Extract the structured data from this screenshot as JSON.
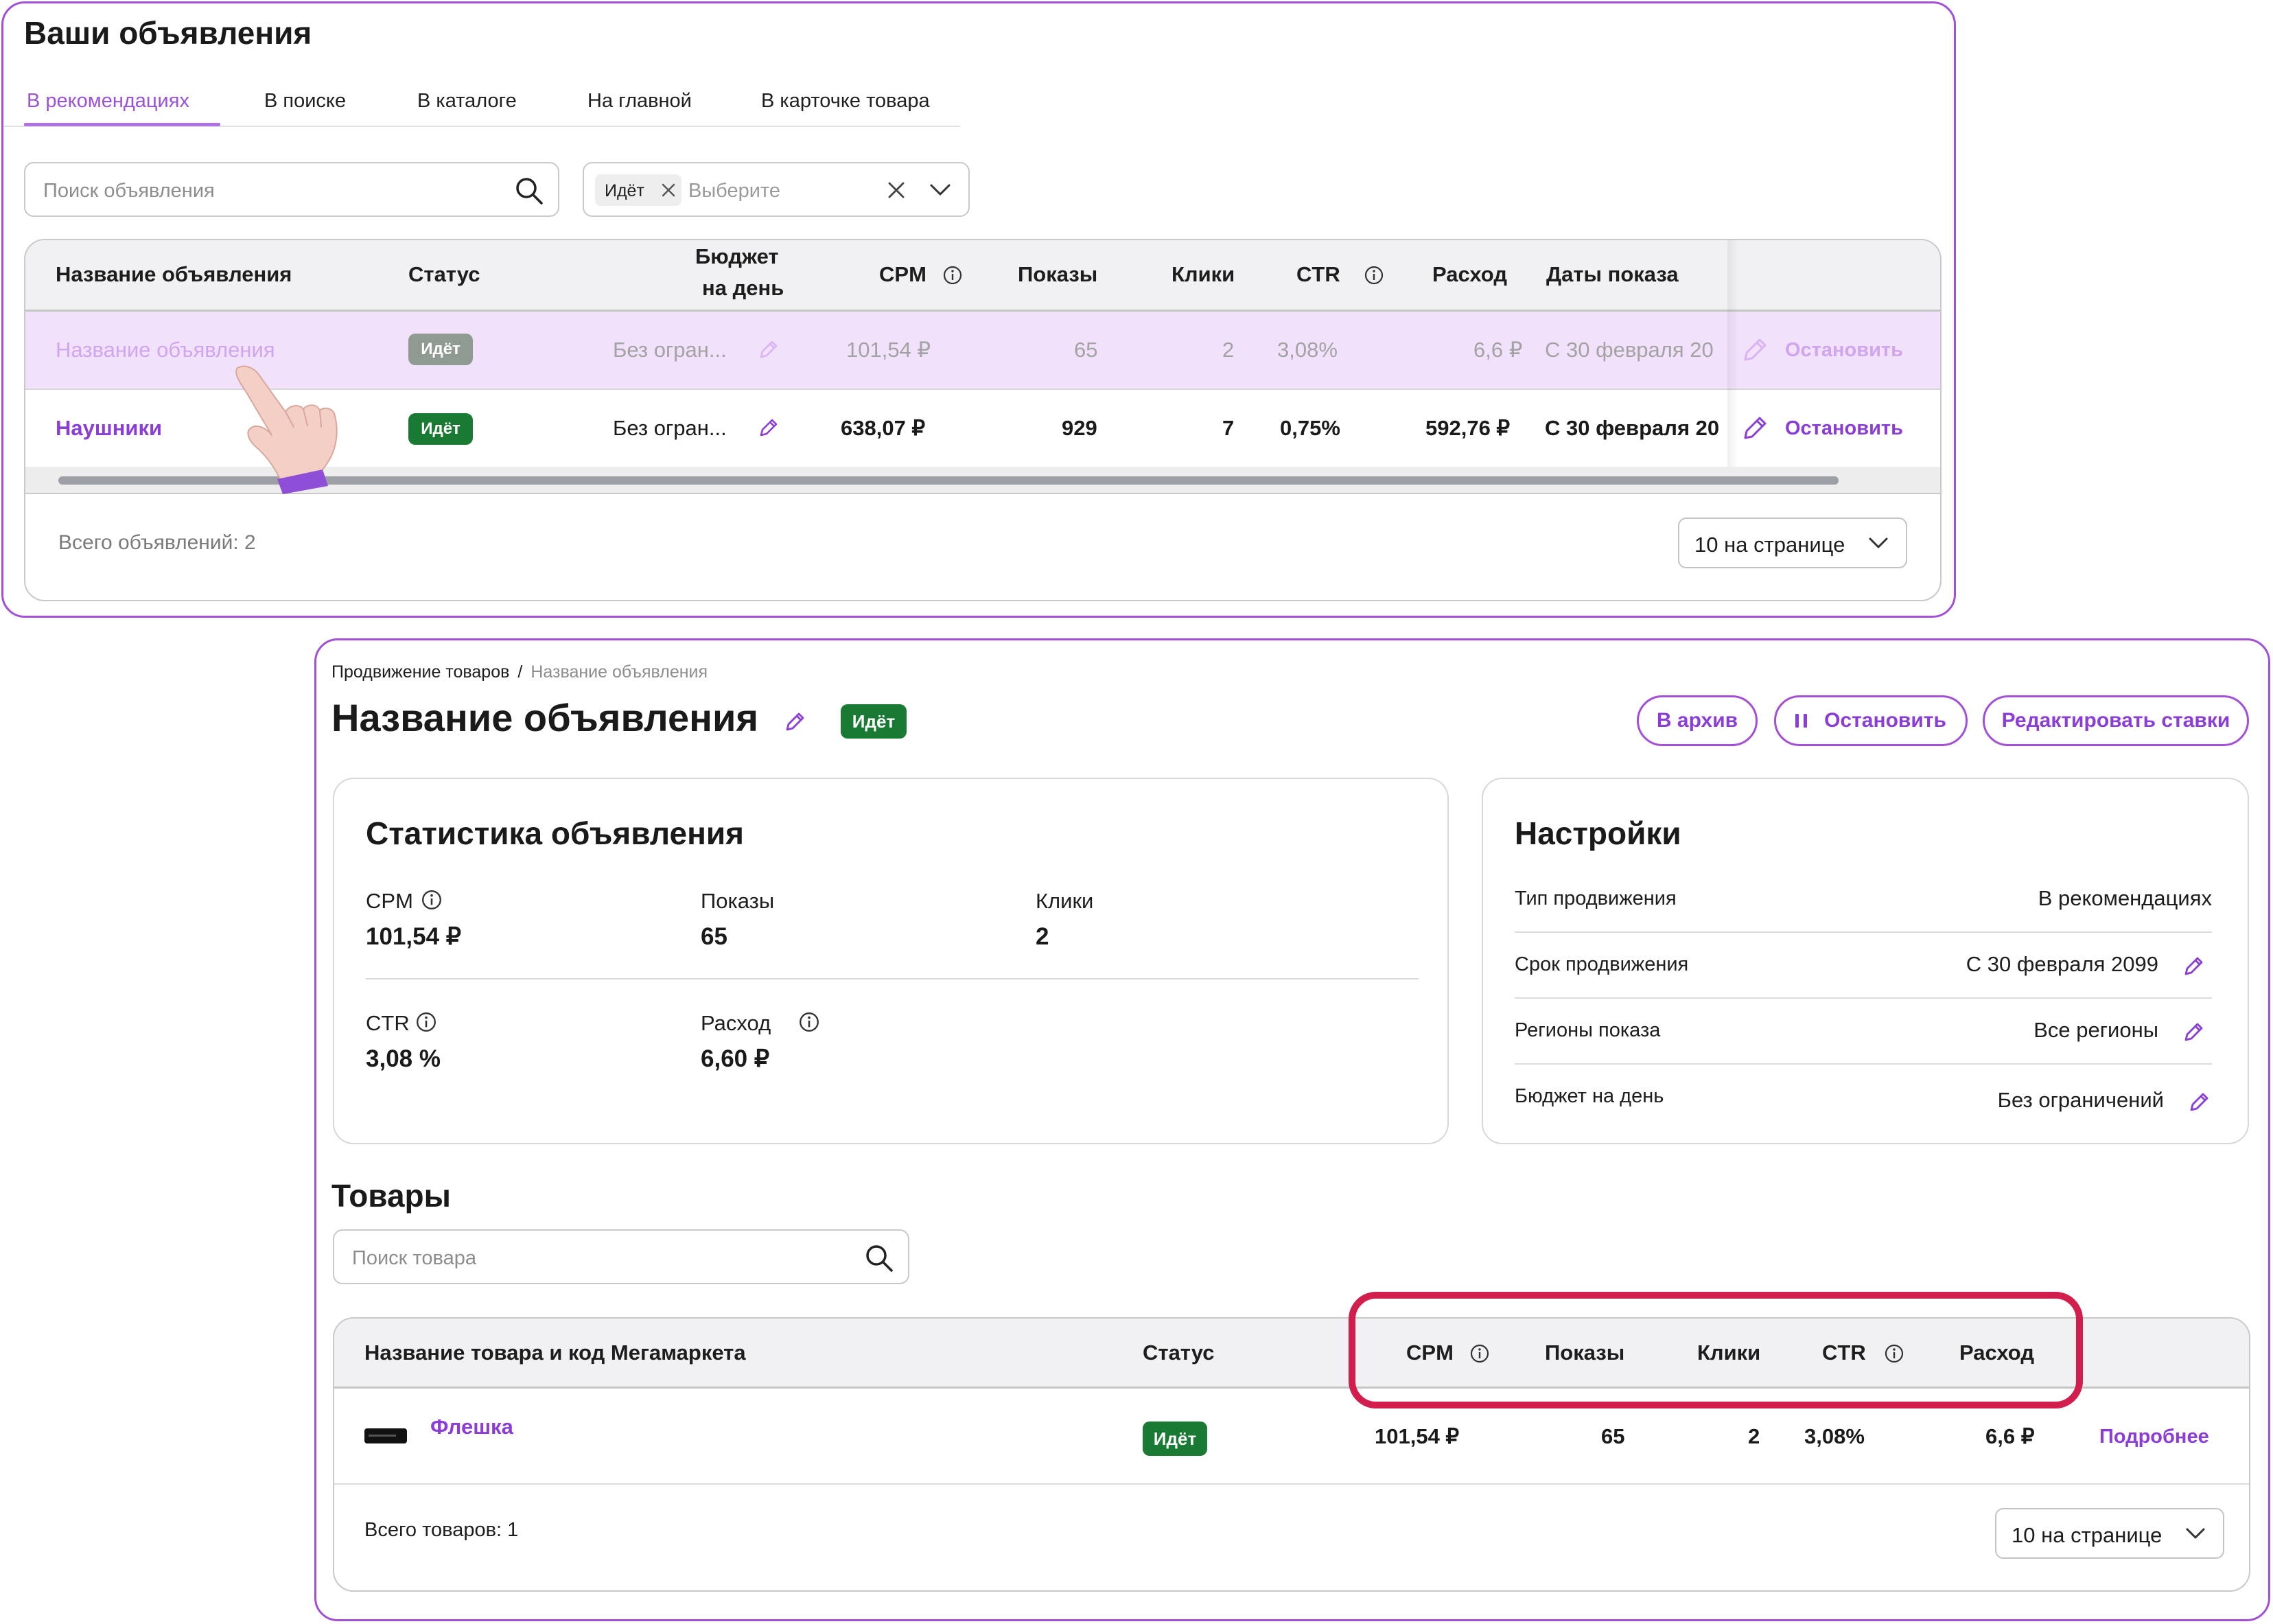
{
  "colors": {
    "accent": "#8b3ed6",
    "success": "#197a33",
    "highlight": "#d21e4c",
    "muted_badge": "#8f9a90"
  },
  "panel1": {
    "title": "Ваши объявления",
    "tabs": [
      "В рекомендациях",
      "В поиске",
      "В каталоге",
      "На главной",
      "В карточке товара"
    ],
    "search": {
      "placeholder": "Поиск объявления"
    },
    "filter": {
      "chip": "Идёт",
      "placeholder": "Выберите"
    },
    "table": {
      "headers": {
        "name": "Название объявления",
        "status": "Статус",
        "budget_1": "Бюджет",
        "budget_2": "на день",
        "cpm": "CPM",
        "shows": "Показы",
        "clicks": "Клики",
        "ctr": "CTR",
        "spend": "Расход",
        "dates": "Даты показа"
      },
      "rows": [
        {
          "name": "Название объявления",
          "status": "Идёт",
          "budget": "Без огран...",
          "cpm": "101,54 ₽",
          "shows": "65",
          "clicks": "2",
          "ctr": "3,08%",
          "spend": "6,6 ₽",
          "dates": "С 30 февраля 20",
          "action": "Остановить"
        },
        {
          "name": "Наушники",
          "status": "Идёт",
          "budget": "Без огран...",
          "cpm": "638,07 ₽",
          "shows": "929",
          "clicks": "7",
          "ctr": "0,75%",
          "spend": "592,76 ₽",
          "dates": "С 30 февраля 20",
          "action": "Остановить"
        }
      ]
    },
    "total": "Всего объявлений: 2",
    "pager": "10 на странице"
  },
  "panel2": {
    "breadcrumb": [
      "Продвижение товаров",
      "/",
      "Название объявления"
    ],
    "title": "Название объявления",
    "status": "Идёт",
    "buttons": {
      "archive": "В архив",
      "stop": "Остановить",
      "edit_bids": "Редактировать ставки"
    },
    "stats": {
      "title": "Статистика объявления",
      "cpm_label": "CPM",
      "cpm": "101,54 ₽",
      "shows_label": "Показы",
      "shows": "65",
      "clicks_label": "Клики",
      "clicks": "2",
      "ctr_label": "CTR",
      "ctr": "3,08 %",
      "spend_label": "Расход",
      "spend": "6,60 ₽"
    },
    "settings": {
      "title": "Настройки",
      "rows": [
        {
          "label": "Тип продвижения",
          "value": "В рекомендациях"
        },
        {
          "label": "Срок продвижения",
          "value": "С 30 февраля 2099"
        },
        {
          "label": "Регионы показа",
          "value": "Все регионы"
        },
        {
          "label": "Бюджет на день",
          "value": "Без ограничений"
        }
      ]
    },
    "goods": {
      "title": "Товары",
      "search_placeholder": "Поиск товара",
      "headers": {
        "name": "Название товара и код Мегамаркета",
        "status": "Статус",
        "cpm": "CPM",
        "shows": "Показы",
        "clicks": "Клики",
        "ctr": "CTR",
        "spend": "Расход"
      },
      "row": {
        "name": "Флешка",
        "status": "Идёт",
        "cpm": "101,54 ₽",
        "shows": "65",
        "clicks": "2",
        "ctr": "3,08%",
        "spend": "6,6 ₽",
        "action": "Подробнее"
      },
      "total": "Всего товаров: 1",
      "pager": "10 на странице"
    }
  }
}
